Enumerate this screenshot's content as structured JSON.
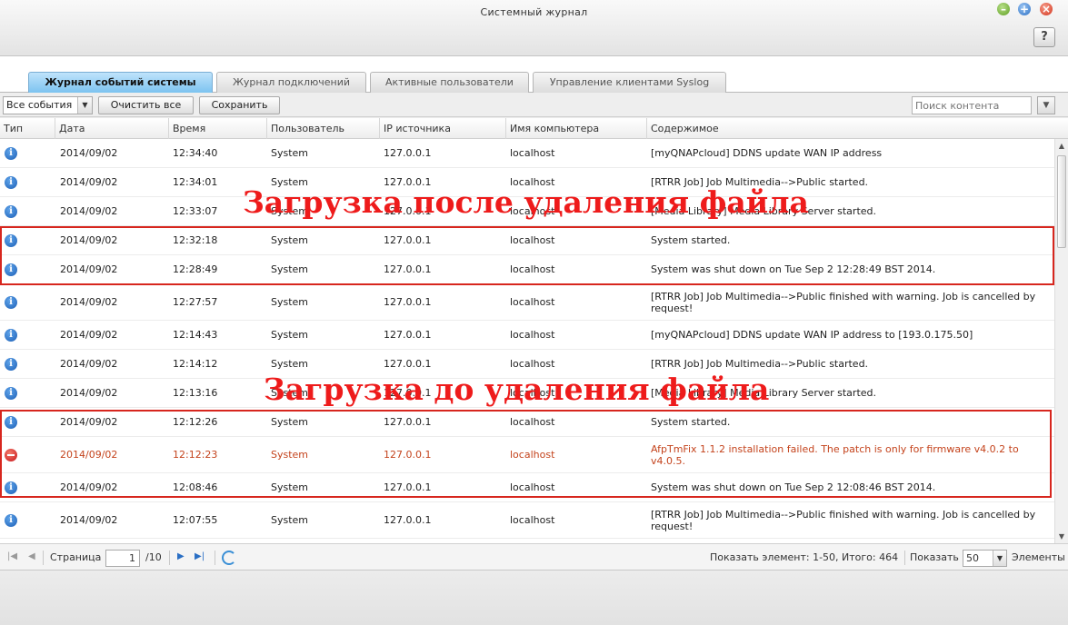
{
  "window": {
    "title": "Системный журнал",
    "help_label": "?"
  },
  "tabs": [
    {
      "label": "Журнал событий системы"
    },
    {
      "label": "Журнал подключений"
    },
    {
      "label": "Активные пользователи"
    },
    {
      "label": "Управление клиентами Syslog"
    }
  ],
  "toolbar": {
    "filter_value": "Все события",
    "clear_label": "Очистить все",
    "save_label": "Сохранить",
    "search_placeholder": "Поиск контента"
  },
  "columns": [
    "Тип",
    "Дата",
    "Время",
    "Пользователь",
    "IP источника",
    "Имя компьютера",
    "Содержимое"
  ],
  "rows": [
    {
      "type": "info",
      "date": "2014/09/02",
      "time": "12:34:40",
      "user": "System",
      "ip": "127.0.0.1",
      "host": "localhost",
      "content": "[myQNAPcloud] DDNS update WAN IP address"
    },
    {
      "type": "info",
      "date": "2014/09/02",
      "time": "12:34:01",
      "user": "System",
      "ip": "127.0.0.1",
      "host": "localhost",
      "content": "[RTRR Job] Job Multimedia-->Public started."
    },
    {
      "type": "info",
      "date": "2014/09/02",
      "time": "12:33:07",
      "user": "System",
      "ip": "127.0.0.1",
      "host": "localhost",
      "content": "[Media Library] Media Library Server started."
    },
    {
      "type": "info",
      "date": "2014/09/02",
      "time": "12:32:18",
      "user": "System",
      "ip": "127.0.0.1",
      "host": "localhost",
      "content": "System started."
    },
    {
      "type": "info",
      "date": "2014/09/02",
      "time": "12:28:49",
      "user": "System",
      "ip": "127.0.0.1",
      "host": "localhost",
      "content": "System was shut down on Tue Sep 2 12:28:49 BST 2014."
    },
    {
      "type": "info",
      "date": "2014/09/02",
      "time": "12:27:57",
      "user": "System",
      "ip": "127.0.0.1",
      "host": "localhost",
      "content": "[RTRR Job] Job Multimedia-->Public finished with warning. Job is cancelled by request!"
    },
    {
      "type": "info",
      "date": "2014/09/02",
      "time": "12:14:43",
      "user": "System",
      "ip": "127.0.0.1",
      "host": "localhost",
      "content": "[myQNAPcloud] DDNS update WAN IP address to [193.0.175.50]"
    },
    {
      "type": "info",
      "date": "2014/09/02",
      "time": "12:14:12",
      "user": "System",
      "ip": "127.0.0.1",
      "host": "localhost",
      "content": "[RTRR Job] Job Multimedia-->Public started."
    },
    {
      "type": "info",
      "date": "2014/09/02",
      "time": "12:13:16",
      "user": "System",
      "ip": "127.0.0.1",
      "host": "localhost",
      "content": "[Media Library] Media Library Server started."
    },
    {
      "type": "info",
      "date": "2014/09/02",
      "time": "12:12:26",
      "user": "System",
      "ip": "127.0.0.1",
      "host": "localhost",
      "content": "System started."
    },
    {
      "type": "error",
      "date": "2014/09/02",
      "time": "12:12:23",
      "user": "System",
      "ip": "127.0.0.1",
      "host": "localhost",
      "content": "AfpTmFix 1.1.2 installation failed. The patch is only for firmware v4.0.2 to v4.0.5."
    },
    {
      "type": "info",
      "date": "2014/09/02",
      "time": "12:08:46",
      "user": "System",
      "ip": "127.0.0.1",
      "host": "localhost",
      "content": "System was shut down on Tue Sep 2 12:08:46 BST 2014."
    },
    {
      "type": "info",
      "date": "2014/09/02",
      "time": "12:07:55",
      "user": "System",
      "ip": "127.0.0.1",
      "host": "localhost",
      "content": "[RTRR Job] Job Multimedia-->Public finished with warning. Job is cancelled by request!"
    }
  ],
  "annotations": {
    "after_delete": "Загрузка после удаления файла",
    "before_delete": "Загрузка до удаления файла"
  },
  "pager": {
    "page_label": "Страница",
    "page_value": "1",
    "of_total": "/10",
    "summary": "Показать элемент: 1-50, Итого: 464",
    "show_label": "Показать",
    "page_size": "50",
    "items_label": "Элементы"
  },
  "colors": {
    "accent": "#7cc3f0",
    "error_text": "#c4431c",
    "annotation": "#ee1b1b"
  }
}
